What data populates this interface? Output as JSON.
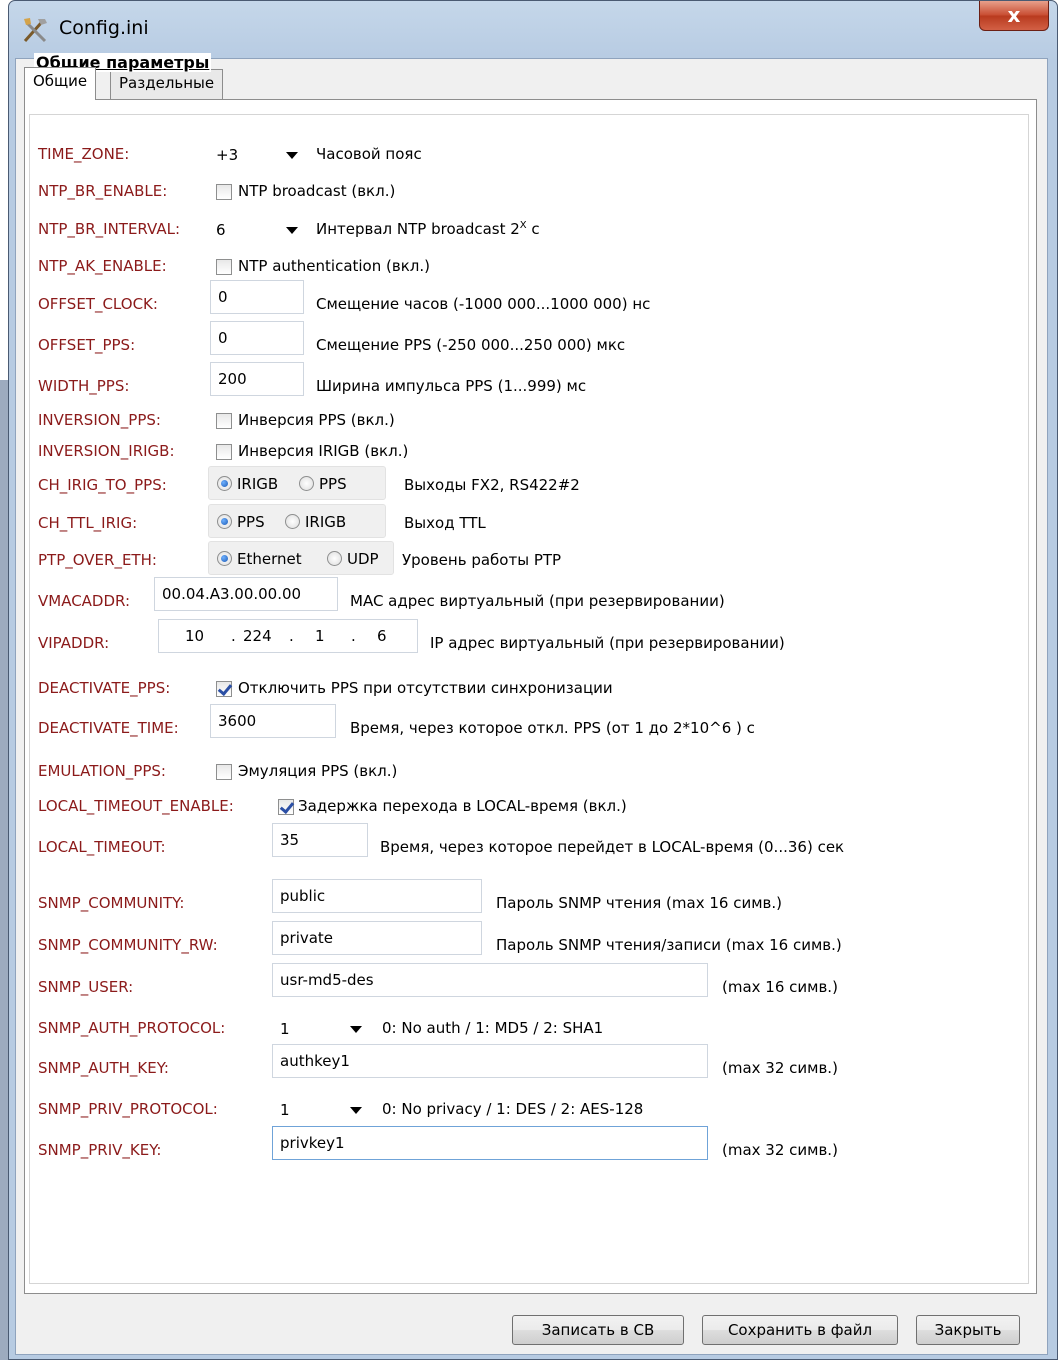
{
  "window": {
    "title": "Config.ini",
    "close_glyph": "x",
    "icon": "tools-icon"
  },
  "tabs": [
    {
      "label": "Общие",
      "active": true
    },
    {
      "label": "Раздельные",
      "active": false
    }
  ],
  "section_title": "Общие параметры",
  "params": {
    "time_zone": {
      "label": "TIME_ZONE:",
      "value": "+3",
      "desc": "Часовой пояс"
    },
    "ntp_br_enable": {
      "label": "NTP_BR_ENABLE:",
      "checked": false,
      "desc": "NTP broadcast (вкл.)"
    },
    "ntp_br_interval": {
      "label": "NTP_BR_INTERVAL:",
      "value": "6",
      "desc": "Интервал NTP broadcast  2",
      "desc_sup": "X",
      "desc_suffix": " с"
    },
    "ntp_ak_enable": {
      "label": "NTP_AK_ENABLE:",
      "checked": false,
      "desc": "NTP authentication (вкл.)"
    },
    "offset_clock": {
      "label": "OFFSET_CLOCK:",
      "value": "0",
      "desc": "Смещение часов (-1000 000...1000 000) нс"
    },
    "offset_pps": {
      "label": "OFFSET_PPS:",
      "value": "0",
      "desc": "Смещение PPS (-250 000...250 000) мкс"
    },
    "width_pps": {
      "label": "WIDTH_PPS:",
      "value": "200",
      "desc": "Ширина импульса PPS (1...999) мс"
    },
    "inversion_pps": {
      "label": "INVERSION_PPS:",
      "checked": false,
      "desc": "Инверсия PPS (вкл.)"
    },
    "inversion_irigb": {
      "label": "INVERSION_IRIGB:",
      "checked": false,
      "desc": "Инверсия IRIGB (вкл.)"
    },
    "ch_irig_to_pps": {
      "label": "CH_IRIG_TO_PPS:",
      "options": [
        "IRIGB",
        "PPS"
      ],
      "selected": "IRIGB",
      "desc": "Выходы FX2, RS422#2"
    },
    "ch_ttl_irig": {
      "label": "CH_TTL_IRIG:",
      "options": [
        "PPS",
        "IRIGB"
      ],
      "selected": "PPS",
      "desc": "Выход TTL"
    },
    "ptp_over_eth": {
      "label": "PTP_OVER_ETH:",
      "options": [
        "Ethernet",
        "UDP"
      ],
      "selected": "Ethernet",
      "desc": "Уровень работы PTP"
    },
    "vmacaddr": {
      "label": "VMACADDR:",
      "value": "00.04.A3.00.00.00",
      "desc": "MAC адрес виртуальный (при резервировании)"
    },
    "vipaddr": {
      "label": "VIPADDR:",
      "octets": [
        "10",
        "224",
        "1",
        "6"
      ],
      "desc": "IP адрес виртуальный (при резервировании)"
    },
    "deactivate_pps": {
      "label": "DEACTIVATE_PPS:",
      "checked": true,
      "desc": "Отключить PPS при отсутствии синхронизации"
    },
    "deactivate_time": {
      "label": "DEACTIVATE_TIME:",
      "value": "3600",
      "desc": "Время, через которое откл. PPS (от 1 до 2*10^6  ) с"
    },
    "emulation_pps": {
      "label": "EMULATION_PPS:",
      "checked": false,
      "desc": "Эмуляция PPS (вкл.)"
    },
    "local_timeout_enable": {
      "label": "LOCAL_TIMEOUT_ENABLE:",
      "checked": true,
      "desc": "Задержка перехода в LOCAL-время (вкл.)"
    },
    "local_timeout": {
      "label": "LOCAL_TIMEOUT:",
      "value": "35",
      "desc": "Время, через которое перейдет в LOCAL-время (0...36) сек"
    },
    "snmp_community": {
      "label": "SNMP_COMMUNITY:",
      "value": "public",
      "desc": "Пароль SNMP чтения (max 16 симв.)"
    },
    "snmp_community_rw": {
      "label": "SNMP_COMMUNITY_RW:",
      "value": "private",
      "desc": "Пароль SNMP чтения/записи (max 16 симв.)"
    },
    "snmp_user": {
      "label": "SNMP_USER:",
      "value": "usr-md5-des",
      "desc": "(max 16 симв.)"
    },
    "snmp_auth_protocol": {
      "label": "SNMP_AUTH_PROTOCOL:",
      "value": "1",
      "desc": "0: No auth / 1: MD5 / 2: SHA1"
    },
    "snmp_auth_key": {
      "label": "SNMP_AUTH_KEY:",
      "value": "authkey1",
      "desc": "(max 32 симв.)"
    },
    "snmp_priv_protocol": {
      "label": "SNMP_PRIV_PROTOCOL:",
      "value": "1",
      "desc": "0: No privacy / 1: DES / 2: AES-128"
    },
    "snmp_priv_key": {
      "label": "SNMP_PRIV_KEY:",
      "value": "privkey1",
      "desc": "(max 32 симв.)"
    }
  },
  "buttons": {
    "write": "Записать в СВ",
    "save": "Сохранить в файл",
    "close": "Закрыть"
  },
  "colors": {
    "label": "#8b1a1a",
    "radio_selected": "#1e5bb5",
    "close_button": "#c74b30"
  }
}
